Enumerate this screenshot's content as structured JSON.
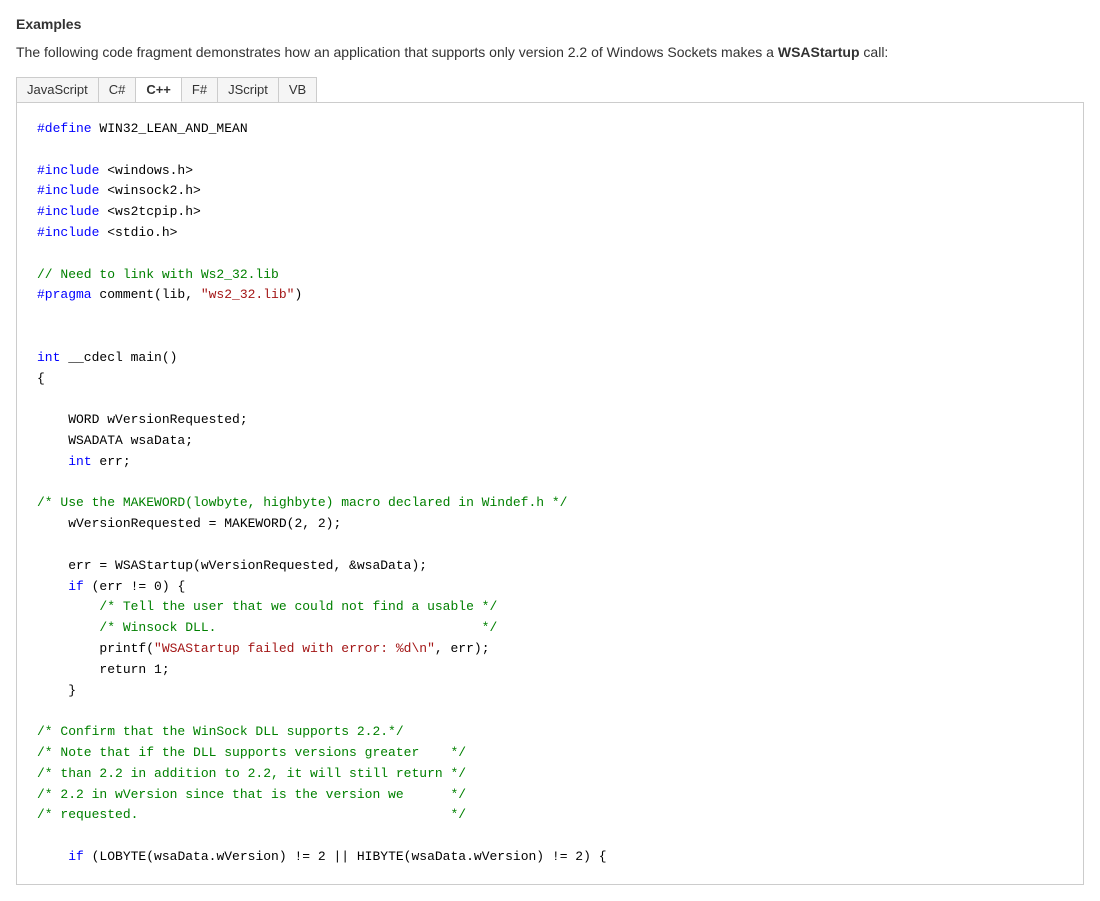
{
  "heading": "Examples",
  "description_start": "The following code fragment demonstrates how an application that supports only version 2.2 of Windows Sockets makes a ",
  "description_bold": "WSAStartup",
  "description_end": " call:",
  "tabs": [
    {
      "label": "JavaScript",
      "active": false
    },
    {
      "label": "C#",
      "active": false
    },
    {
      "label": "C++",
      "active": true
    },
    {
      "label": "F#",
      "active": false
    },
    {
      "label": "JScript",
      "active": false
    },
    {
      "label": "VB",
      "active": false
    }
  ]
}
